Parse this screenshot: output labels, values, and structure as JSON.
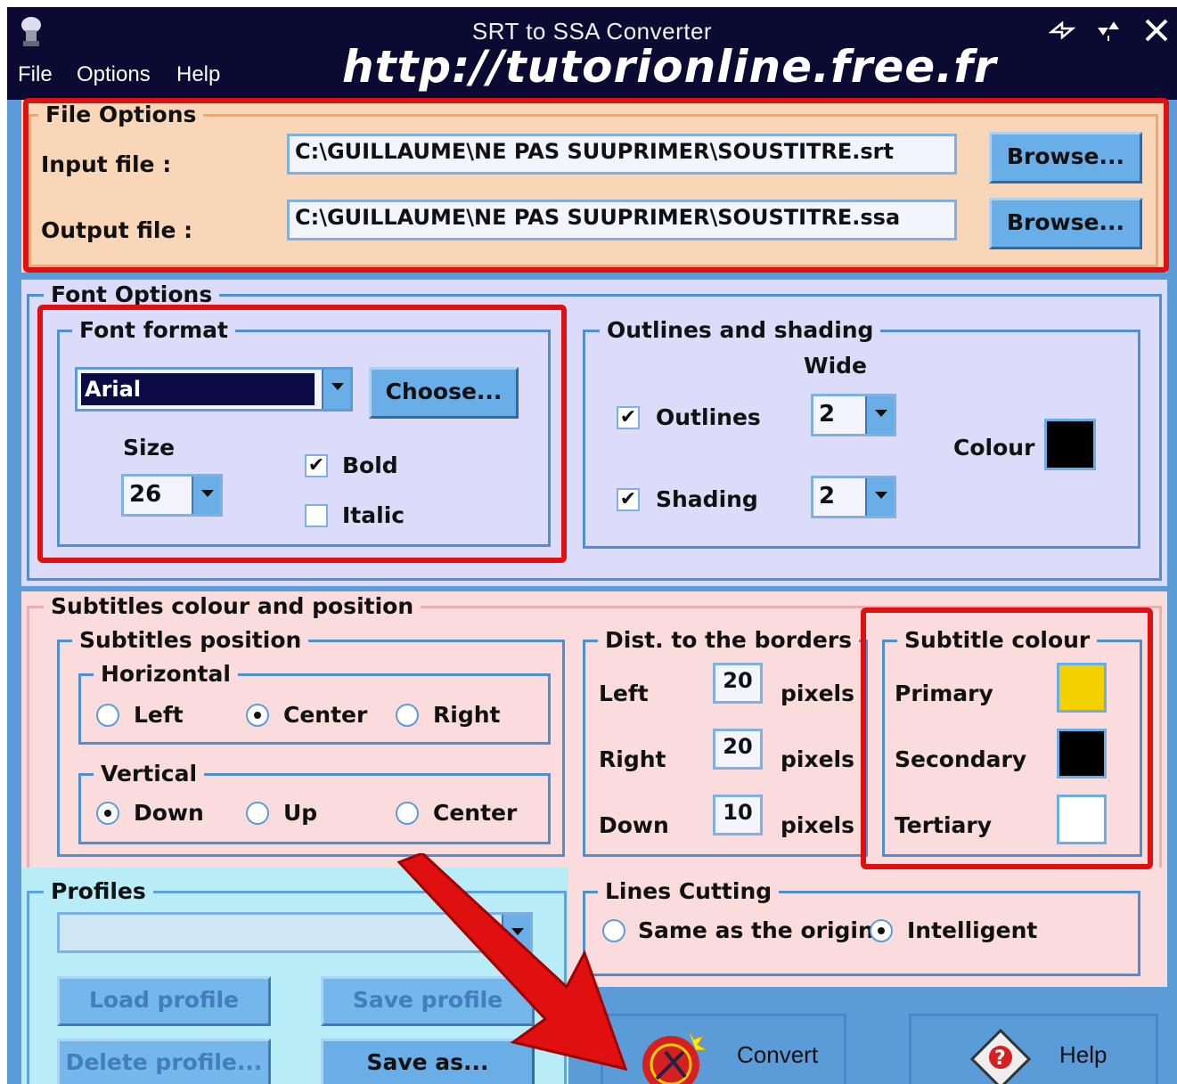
{
  "window": {
    "title": "SRT to SSA Converter",
    "watermark": "http://tutorionline.free.fr",
    "menu": [
      "File",
      "Options",
      "Help"
    ],
    "controls": [
      "minimize-icon",
      "restore-icon",
      "close-icon"
    ]
  },
  "file_options": {
    "legend": "File Options",
    "input_label": "Input file :",
    "input_value": "C:\\GUILLAUME\\NE PAS SUUPRIMER\\SOUSTITRE.srt",
    "output_label": "Output file :",
    "output_value": "C:\\GUILLAUME\\NE PAS SUUPRIMER\\SOUSTITRE.ssa",
    "browse_label": "Browse..."
  },
  "font_options": {
    "legend": "Font Options",
    "format": {
      "legend": "Font format",
      "font_value": "Arial",
      "choose_label": "Choose...",
      "size_label": "Size",
      "size_value": "26",
      "bold_label": "Bold",
      "bold_checked": true,
      "italic_label": "Italic",
      "italic_checked": false
    },
    "outlines": {
      "legend": "Outlines and shading",
      "wide_label": "Wide",
      "outlines_label": "Outlines",
      "outlines_checked": true,
      "outlines_value": "2",
      "shading_label": "Shading",
      "shading_checked": true,
      "shading_value": "2",
      "colour_label": "Colour",
      "colour": "#000000"
    }
  },
  "subtitles": {
    "legend": "Subtitles colour and position",
    "position": {
      "legend": "Subtitles position",
      "horizontal_legend": "Horizontal",
      "horizontal": [
        "Left",
        "Center",
        "Right"
      ],
      "horizontal_selected": "Center",
      "vertical_legend": "Vertical",
      "vertical": [
        "Down",
        "Up",
        "Center"
      ],
      "vertical_selected": "Down"
    },
    "borders": {
      "legend": "Dist. to the borders",
      "unit": "pixels",
      "rows": [
        {
          "label": "Left",
          "value": "20"
        },
        {
          "label": "Right",
          "value": "20"
        },
        {
          "label": "Down",
          "value": "10"
        }
      ]
    },
    "colour": {
      "legend": "Subtitle colour",
      "primary_label": "Primary",
      "primary": "#f5d000",
      "secondary_label": "Secondary",
      "secondary": "#000000",
      "tertiary_label": "Tertiary",
      "tertiary": "#ffffff"
    }
  },
  "profiles": {
    "legend": "Profiles",
    "select_value": "",
    "load_label": "Load profile",
    "save_label": "Save profile",
    "delete_label": "Delete profile...",
    "save_as_label": "Save as..."
  },
  "lines_cutting": {
    "legend": "Lines Cutting",
    "options": [
      "Same as the origina",
      "Intelligent"
    ],
    "selected": "Intelligent"
  },
  "actions": {
    "convert_label": "Convert",
    "help_label": "Help"
  }
}
